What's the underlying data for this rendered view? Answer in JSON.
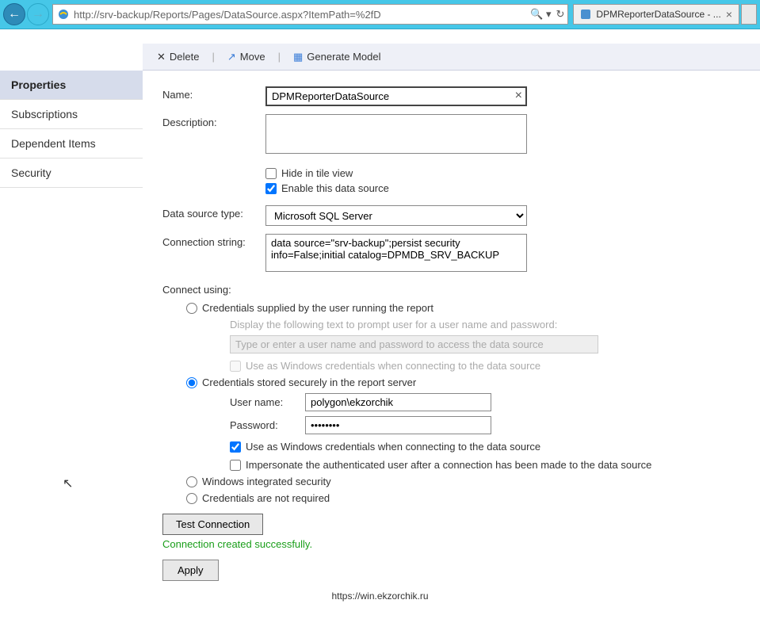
{
  "browser": {
    "url": "http://srv-backup/Reports/Pages/DataSource.aspx?ItemPath=%2fD",
    "search_hint": "",
    "tab_title": "DPMReporterDataSource - ..."
  },
  "toolbar": {
    "delete": "Delete",
    "move": "Move",
    "generate_model": "Generate Model"
  },
  "sidebar": {
    "properties": "Properties",
    "subscriptions": "Subscriptions",
    "dependent_items": "Dependent Items",
    "security": "Security"
  },
  "form": {
    "name_label": "Name:",
    "name_value": "DPMReporterDataSource",
    "description_label": "Description:",
    "description_value": "",
    "hide_tile_label": "Hide in tile view",
    "enable_ds_label": "Enable this data source",
    "ds_type_label": "Data source type:",
    "ds_type_value": "Microsoft SQL Server",
    "conn_label": "Connection string:",
    "conn_value": "data source=\"srv-backup\";persist security info=False;initial catalog=DPMDB_SRV_BACKUP",
    "connect_using": "Connect using:",
    "radio_user_supplied": "Credentials supplied by the user running the report",
    "prompt_hint": "Display the following text to prompt user for a user name and password:",
    "prompt_placeholder": "Type or enter a user name and password to access the data source",
    "use_windows_disabled": "Use as Windows credentials when connecting to the data source",
    "radio_stored": "Credentials stored securely in the report server",
    "username_label": "User name:",
    "username_value": "polygon\\ekzorchik",
    "password_label": "Password:",
    "password_value": "••••••••",
    "use_windows_stored": "Use as Windows credentials when connecting to the data source",
    "impersonate": "Impersonate the authenticated user after a connection has been made to the data source",
    "radio_integrated": "Windows integrated security",
    "radio_not_required": "Credentials are not required",
    "test_btn": "Test Connection",
    "status": "Connection created successfully.",
    "apply_btn": "Apply"
  },
  "watermark": "https://win.ekzorchik.ru"
}
